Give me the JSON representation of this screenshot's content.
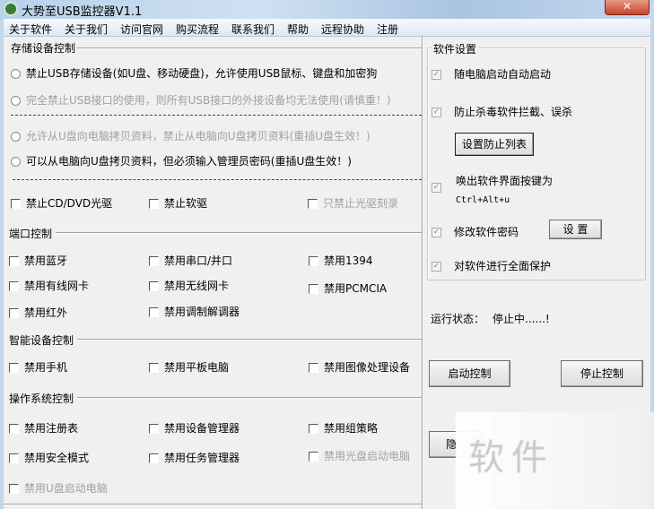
{
  "window": {
    "title": "大势至USB监控器V1.1",
    "close": "✕"
  },
  "menu": [
    "关于软件",
    "关于我们",
    "访问官网",
    "购买流程",
    "联系我们",
    "帮助",
    "远程协助",
    "注册"
  ],
  "storage": {
    "label": "存储设备控制",
    "radios": [
      "禁止USB存储设备(如U盘、移动硬盘)，允许使用USB鼠标、键盘和加密狗",
      "完全禁止USB接口的使用，则所有USB接口的外接设备均无法使用(请慎重！)",
      "允许从U盘向电脑拷贝资料，禁止从电脑向U盘拷贝资料(重插U盘生效！)",
      "可以从电脑向U盘拷贝资料，但必须输入管理员密码(重插U盘生效！)"
    ],
    "checks": [
      "禁止CD/DVD光驱",
      "禁止软驱",
      "只禁止光驱刻录"
    ]
  },
  "port": {
    "label": "端口控制",
    "checks": [
      "禁用蓝牙",
      "禁用串口/并口",
      "禁用1394",
      "禁用有线网卡",
      "禁用无线网卡",
      "禁用PCMCIA",
      "禁用红外",
      "禁用调制解调器"
    ]
  },
  "smart": {
    "label": "智能设备控制",
    "checks": [
      "禁用手机",
      "禁用平板电脑",
      "禁用图像处理设备"
    ]
  },
  "os": {
    "label": "操作系统控制",
    "checks": [
      "禁用注册表",
      "禁用设备管理器",
      "禁用组策略",
      "禁用安全模式",
      "禁用任务管理器",
      "禁用光盘启动电脑",
      "禁用U盘启动电脑"
    ]
  },
  "settings": {
    "label": "软件设置",
    "auto_start": "随电脑启动自动启动",
    "anti_kill": "防止杀毒软件拦截、误杀",
    "set_list": "设置防止列表",
    "hotkey_label": "唤出软件界面按键为",
    "hotkey": "Ctrl+Alt+u",
    "change_pwd": "修改软件密码",
    "set_btn": "设 置",
    "protect": "对软件进行全面保护",
    "check": "✓"
  },
  "status": {
    "label": "运行状态：",
    "value": "停止中......!"
  },
  "buttons": {
    "start": "启动控制",
    "stop": "停止控制",
    "hide": "隐"
  },
  "watermark": "软件"
}
